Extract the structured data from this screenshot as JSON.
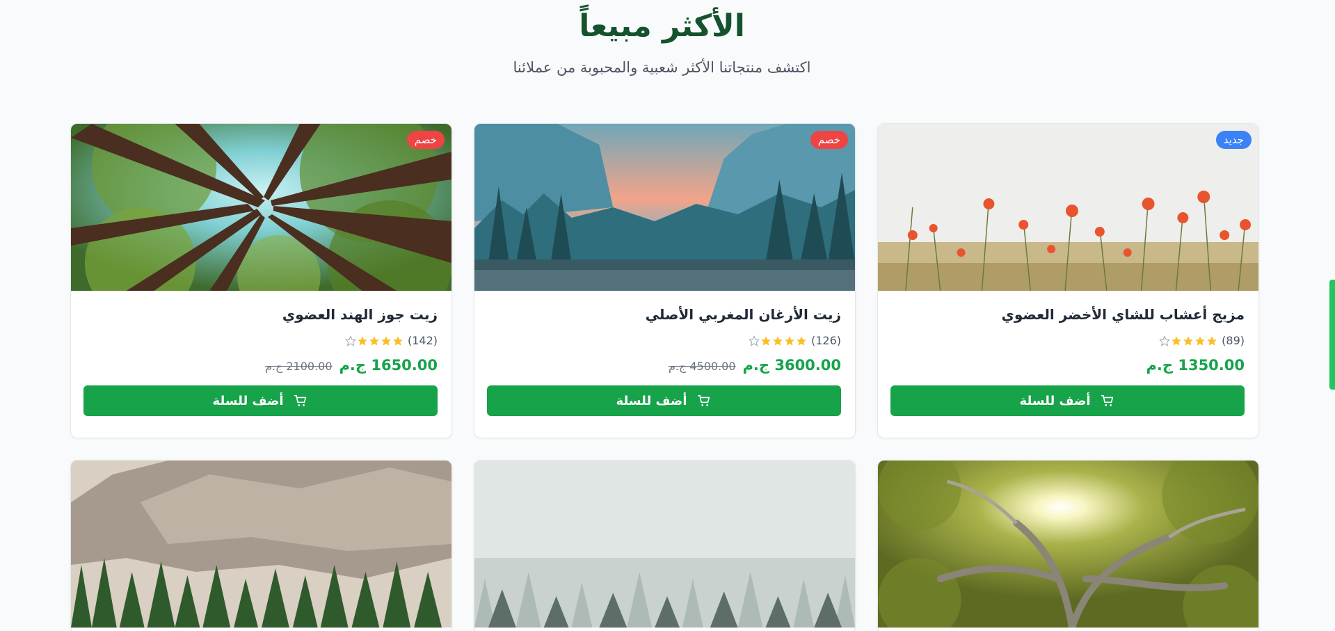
{
  "section": {
    "title": "الأكثر مبيعاً",
    "subtitle": "اكتشف منتجاتنا الأكثر شعبية والمحبوبة من عملائنا"
  },
  "colors": {
    "brand_green": "#16a34a",
    "title_green": "#14532d",
    "badge_sale": "#ef4444",
    "badge_new": "#3b82f6",
    "star_gold": "#fbbf24"
  },
  "products": [
    {
      "name": "زيت جوز الهند العضوي",
      "badge": "خصم",
      "badge_type": "sale",
      "rating": 4,
      "reviews": "(142)",
      "price": "1650.00 ج.م",
      "old_price": "2100.00 ج.م",
      "button": "أضف للسلة",
      "image": "redwood-canopy"
    },
    {
      "name": "زيت الأرغان المغربي الأصلي",
      "badge": "خصم",
      "badge_type": "sale",
      "rating": 4,
      "reviews": "(126)",
      "price": "3600.00 ج.م",
      "old_price": "4500.00 ج.م",
      "button": "أضف للسلة",
      "image": "valley-lake"
    },
    {
      "name": "مزيج أعشاب للشاي الأخضر العضوي",
      "badge": "جديد",
      "badge_type": "new",
      "rating": 4,
      "reviews": "(89)",
      "price": "1350.00 ج.م",
      "old_price": "",
      "button": "أضف للسلة",
      "image": "poppy-field"
    }
  ],
  "partial_products": [
    {
      "image": "granite-cliff"
    },
    {
      "image": "misty-forest"
    },
    {
      "image": "sunlit-tree"
    }
  ]
}
